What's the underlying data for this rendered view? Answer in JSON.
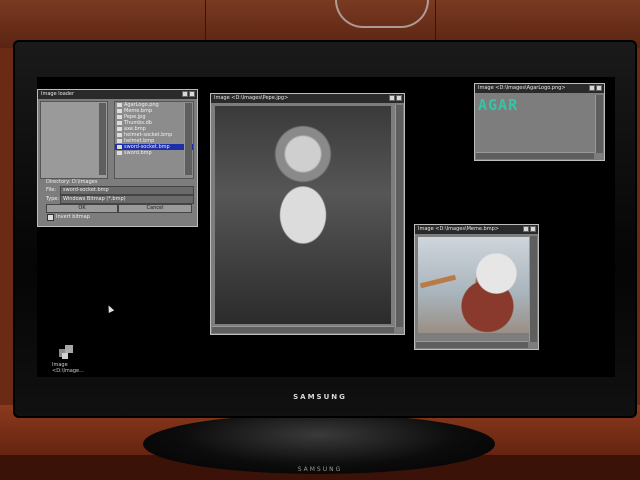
{
  "loader": {
    "title": "Image loader",
    "files": [
      "AgarLogo.png",
      "Meme.bmp",
      "Pepe.jpg",
      "Thumbs.db",
      "axe.bmp",
      "helmet-socket.bmp",
      "helmet.bmp",
      "sword-socket.bmp",
      "sword.bmp"
    ],
    "selected_file": "sword-socket.bmp",
    "directory_label": "Directory: D:\\Images",
    "file_label": "File:",
    "file_value": "sword-socket.bmp",
    "type_label": "Type:",
    "type_value": "Windows Bitmap (*.bmp)",
    "ok_label": "OK",
    "cancel_label": "Cancel",
    "invert_label": "Invert bitmap"
  },
  "windows": {
    "pepe_title": "Image <D:\\Images\\Pepe.jpg>",
    "agar_title": "Image <D:\\Images\\AgarLogo.png>",
    "agar_text": "AGAR",
    "meme_title": "Image <D:\\Images\\Meme.bmp>"
  },
  "desktop": {
    "icon_label": "Image\n<D:\\Image..."
  },
  "tv": {
    "brand": "SAMSUNG"
  }
}
